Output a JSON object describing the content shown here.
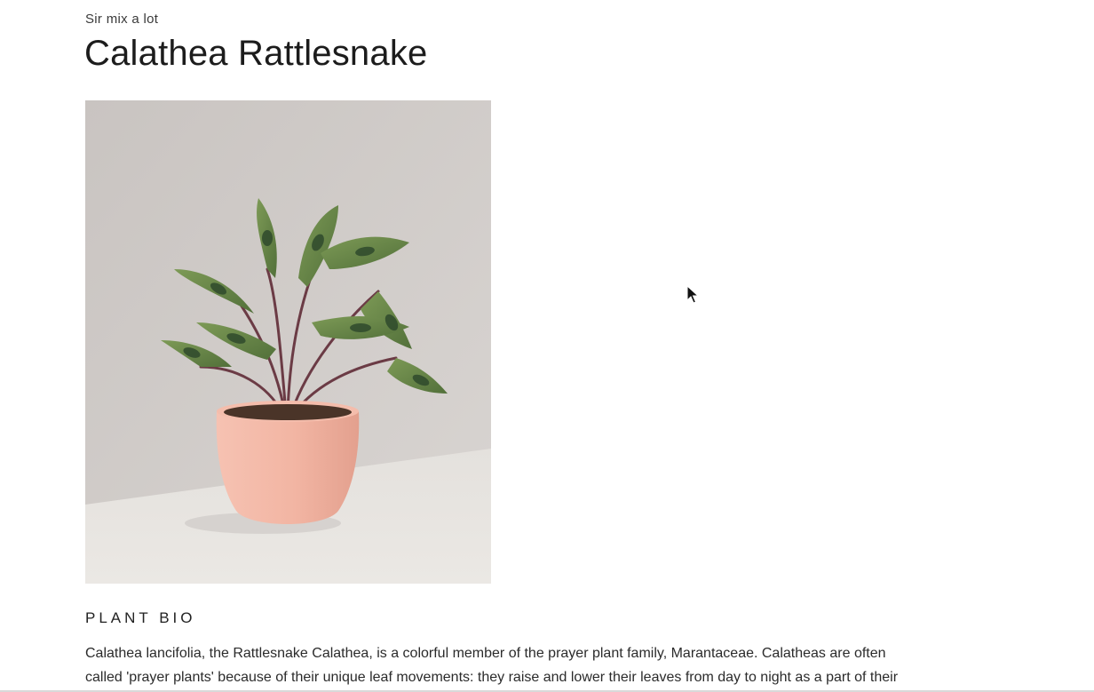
{
  "header": {
    "brand": "Sir mix a lot",
    "title": "Calathea Rattlesnake"
  },
  "product_image": {
    "icon": "potted-calathea-plant-photo",
    "colors": {
      "wall": "#cbc7c4",
      "table": "#e6e3df",
      "pot": "#f2b7a6",
      "leaf_dark": "#2f4a2c",
      "leaf_light": "#6d8a4a"
    }
  },
  "section": {
    "heading": "PLANT BIO",
    "bio_line_1": "Calathea lancifolia, the Rattlesnake Calathea, is a colorful member of the prayer plant family, Marantaceae. Calatheas are often",
    "bio_line_2": "called 'prayer plants' because of their unique leaf movements: they raise and lower their leaves from day to night as a part of their"
  },
  "cursor": {
    "icon": "mouse-pointer-icon"
  }
}
